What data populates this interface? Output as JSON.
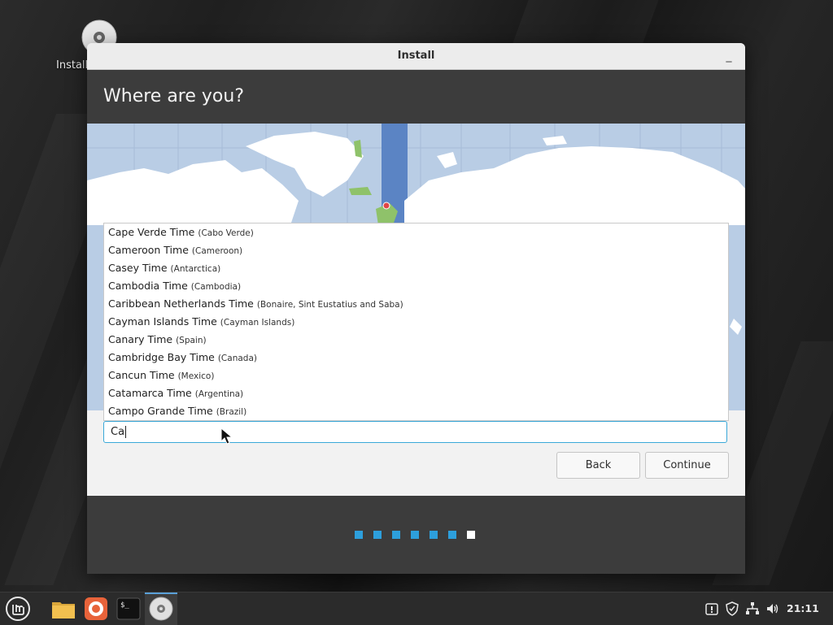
{
  "desktop": {
    "icon_label": "Install"
  },
  "window": {
    "title": "Install",
    "minimize_symbol": "_",
    "heading": "Where are you?"
  },
  "timezones": [
    {
      "name": "Cape Verde Time",
      "region": "(Cabo Verde)"
    },
    {
      "name": "Cameroon Time",
      "region": "(Cameroon)"
    },
    {
      "name": "Casey Time",
      "region": "(Antarctica)"
    },
    {
      "name": "Cambodia Time",
      "region": "(Cambodia)"
    },
    {
      "name": "Caribbean Netherlands Time",
      "region": "(Bonaire, Sint Eustatius and Saba)"
    },
    {
      "name": "Cayman Islands Time",
      "region": "(Cayman Islands)"
    },
    {
      "name": "Canary Time",
      "region": "(Spain)"
    },
    {
      "name": "Cambridge Bay Time",
      "region": "(Canada)"
    },
    {
      "name": "Cancun Time",
      "region": "(Mexico)"
    },
    {
      "name": "Catamarca Time",
      "region": "(Argentina)"
    },
    {
      "name": "Campo Grande Time",
      "region": "(Brazil)"
    }
  ],
  "search": {
    "value": "Ca"
  },
  "buttons": {
    "back": "Back",
    "continue": "Continue"
  },
  "progress": {
    "total_steps": 7,
    "current_step": 7
  },
  "colors": {
    "accent": "#3aa8d8",
    "step_done": "#2d9fdc",
    "step_current": "#ffffff",
    "map_water": "#b9cde5",
    "selected_zone": "#5b84c4"
  },
  "taskbar": {
    "icons": [
      "mint-menu-icon",
      "files-icon",
      "firefox-icon",
      "terminal-icon",
      "installer-disc-icon"
    ],
    "tray_icons": [
      "update-manager-icon",
      "shield-icon",
      "network-icon",
      "volume-icon"
    ],
    "clock": "21:11"
  }
}
